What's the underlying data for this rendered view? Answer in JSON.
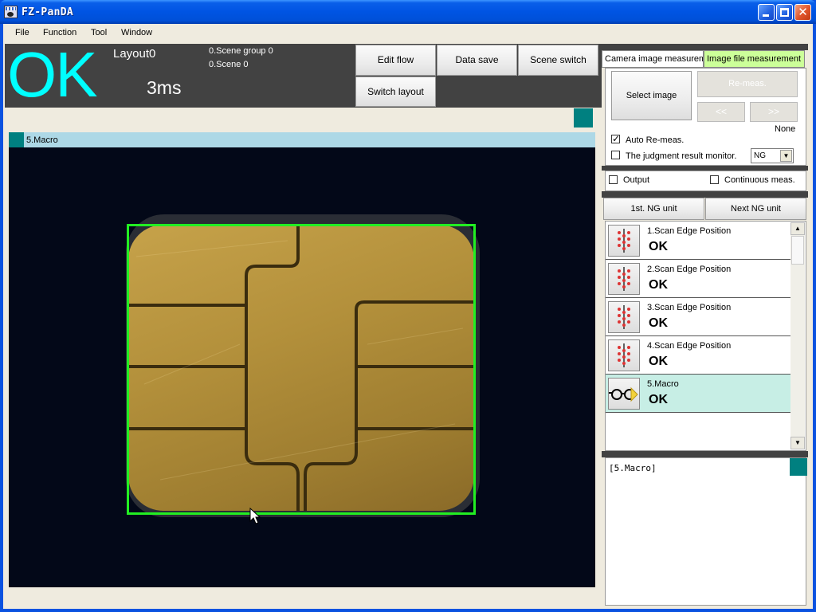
{
  "window": {
    "title": "FZ-PanDA"
  },
  "menu": [
    "File",
    "Function",
    "Tool",
    "Window"
  ],
  "status": {
    "judgement": "OK",
    "layout": "Layout0",
    "elapsed": "3ms",
    "scene_group": "0.Scene group 0",
    "scene": "0.Scene 0"
  },
  "toolbar": {
    "edit_flow": "Edit flow",
    "data_save": "Data save",
    "scene_switch": "Scene switch",
    "switch_layout": "Switch layout"
  },
  "image_panel": {
    "header": "5.Macro"
  },
  "tabs": {
    "camera": "Camera image measurement",
    "file": "Image file measurement"
  },
  "file_panel": {
    "select_image": "Select image",
    "re_meas": "Re-meas.",
    "prev": "<<",
    "next": ">>",
    "file_name": "None",
    "auto_remeas": "Auto Re-meas.",
    "judgment_monitor": "The judgment result monitor.",
    "monitor_value": "NG"
  },
  "options": {
    "output": "Output",
    "continuous": "Continuous meas."
  },
  "nav": {
    "first_ng": "1st. NG unit",
    "next_ng": "Next NG unit"
  },
  "units": [
    {
      "name": "1.Scan Edge Position",
      "result": "OK",
      "icon": "scan-edge-icon"
    },
    {
      "name": "2.Scan Edge Position",
      "result": "OK",
      "icon": "scan-edge-icon"
    },
    {
      "name": "3.Scan Edge Position",
      "result": "OK",
      "icon": "scan-edge-icon"
    },
    {
      "name": "4.Scan Edge Position",
      "result": "OK",
      "icon": "scan-edge-icon"
    },
    {
      "name": "5.Macro",
      "result": "OK",
      "icon": "macro-glasses-icon"
    }
  ],
  "detail": {
    "text": "[5.Macro]"
  },
  "colors": {
    "ok": "#00ffff",
    "roi": "#22ee22",
    "selected_row": "#c7eee5",
    "header": "#add8e6",
    "teal": "#008080"
  }
}
